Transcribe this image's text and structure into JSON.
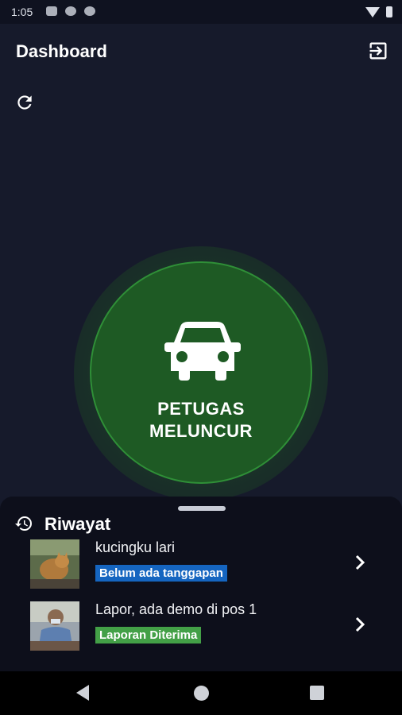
{
  "status": {
    "time": "1:05"
  },
  "appbar": {
    "title": "Dashboard"
  },
  "launch": {
    "line1": "PETUGAS",
    "line2": "MELUNCUR",
    "color": "#1e5a24"
  },
  "history": {
    "title": "Riwayat",
    "items": [
      {
        "text": "kucingku lari",
        "status": "Belum ada tanggapan",
        "status_color": "#1565c0"
      },
      {
        "text": "Lapor, ada demo di pos 1",
        "status": "Laporan Diterima",
        "status_color": "#43a047"
      }
    ]
  },
  "icons": {
    "logout": "logout-icon",
    "refresh": "refresh-icon",
    "car": "car-icon",
    "history": "history-icon",
    "chevron": "chevron-right-icon"
  }
}
